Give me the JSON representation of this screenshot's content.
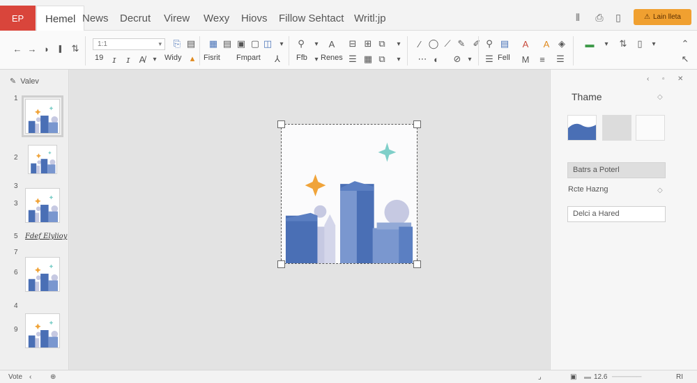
{
  "app": {
    "badge": "EP"
  },
  "tabs": [
    {
      "label": "Hemel",
      "active": true
    },
    {
      "label": "News"
    },
    {
      "label": "Decrut"
    },
    {
      "label": "Virew"
    },
    {
      "label": "Wexy"
    },
    {
      "label": "Hiovs"
    },
    {
      "label": "Fillow Sehtact"
    },
    {
      "label": "Writl:jp"
    }
  ],
  "topbar": {
    "orange_button": "Lain lleta",
    "colors": {
      "accent": "#f0a030",
      "badge": "#d9453b"
    }
  },
  "ribbon": {
    "font_name": "1:1",
    "labels": {
      "width": "Widy",
      "insert": "Fisrit",
      "format": "Fmpart",
      "fit": "Ffb",
      "rename": "Renes",
      "fill": "Fell"
    },
    "size_label": "19"
  },
  "slides_panel": {
    "header": "Valev",
    "numbers": [
      "1",
      "2",
      "3",
      "5",
      "7",
      "6",
      "4",
      "3",
      "9"
    ],
    "section_label": "Fdef Elylioy"
  },
  "right_pane": {
    "title": "Thame",
    "button_grey": "Batrs a Poterl",
    "text_item": "Rcte Hazng",
    "button_white": "Delci a Hared"
  },
  "statusbar": {
    "left_label": "Vote",
    "zoom": "12.6",
    "right": "RI"
  },
  "illustration_colors": {
    "blue_dark": "#4a6fb5",
    "blue_mid": "#7a97cf",
    "lavender": "#c6c9e2",
    "star_orange": "#f0a43a",
    "star_teal": "#7fcfc9"
  }
}
